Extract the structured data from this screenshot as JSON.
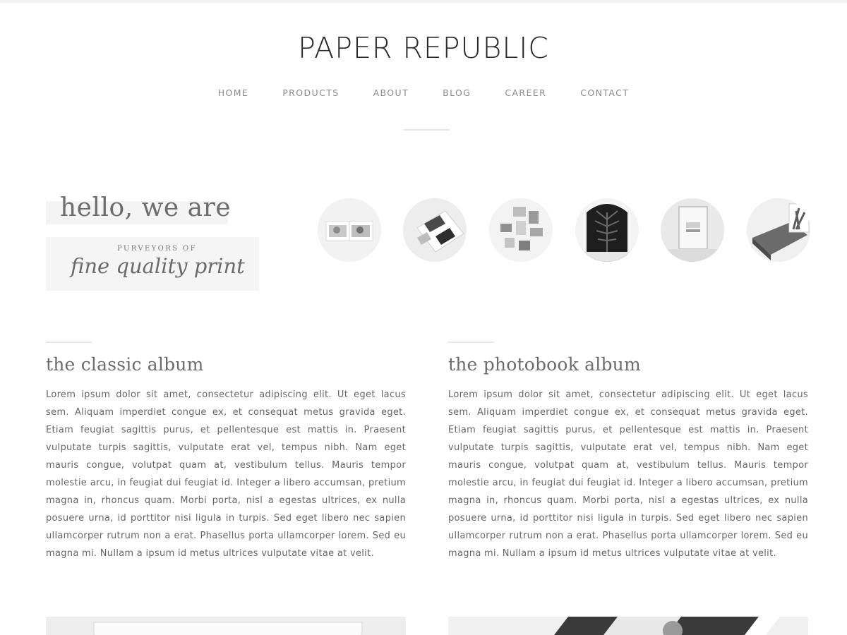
{
  "site": {
    "title": "PAPER REPUBLIC"
  },
  "nav": {
    "items": [
      "HOME",
      "PRODUCTS",
      "ABOUT",
      "BLOG",
      "CAREER",
      "CONTACT"
    ]
  },
  "hero": {
    "hello": "hello, we are",
    "purveyors": "PURVEYORS OF",
    "tagline": "fine quality print"
  },
  "gallery": {
    "thumbnails": [
      "open-photo-album",
      "printed-photobook",
      "wall-photo-collage",
      "framed-palm-print",
      "framed-art-print",
      "wooden-block-print"
    ]
  },
  "sections": [
    {
      "title": "the classic album",
      "body": "Lorem ipsum dolor sit amet, consectetur adipiscing elit. Ut eget lacus sem. Aliquam imperdiet congue ex, et consequat metus gravida eget. Etiam feugiat sagittis purus, et pellentesque est mattis in. Praesent vulputate turpis sagittis, vulputate erat vel, tempus nibh. Nam eget mauris congue, volutpat quam at, vestibulum tellus. Mauris tempor molestie arcu, in feugiat dui feugiat id. Integer a libero accumsan, pretium magna in, rhoncus quam. Morbi porta, nisl a egestas ultrices, ex nulla posuere urna, id porttitor nisi ligula in turpis. Sed eget libero nec sapien ullamcorper rutrum non a erat. Phasellus porta ullamcorper lorem. Sed eu magna mi. Nullam a ipsum id metus ultrices vulputate vitae at velit."
    },
    {
      "title": "the photobook album",
      "body": "Lorem ipsum dolor sit amet, consectetur adipiscing elit. Ut eget lacus sem. Aliquam imperdiet congue ex, et consequat metus gravida eget. Etiam feugiat sagittis purus, et pellentesque est mattis in. Praesent vulputate turpis sagittis, vulputate erat vel, tempus nibh. Nam eget mauris congue, volutpat quam at, vestibulum tellus. Mauris tempor molestie arcu, in feugiat dui feugiat id. Integer a libero accumsan, pretium magna in, rhoncus quam. Morbi porta, nisl a egestas ultrices, ex nulla posuere urna, id porttitor nisi ligula in turpis. Sed eget libero nec sapien ullamcorper rutrum non a erat. Phasellus porta ullamcorper lorem. Sed eu magna mi. Nullam a ipsum id metus ultrices vulputate vitae at velit."
    }
  ]
}
